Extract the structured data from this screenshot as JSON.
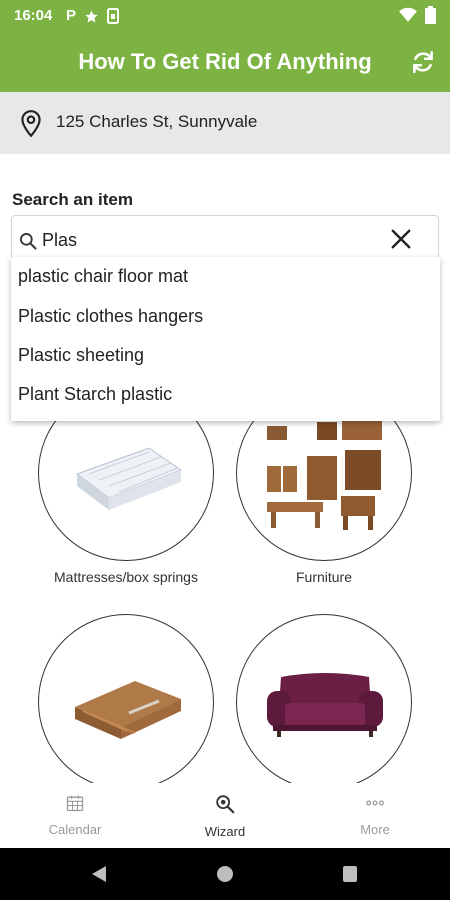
{
  "status_bar": {
    "time": "16:04",
    "left_icons": [
      "parking-icon",
      "star-icon",
      "sim-icon"
    ],
    "right_icons": [
      "wifi-icon",
      "battery-icon"
    ]
  },
  "app_bar": {
    "title": "How To Get Rid Of Anything",
    "background": "#7cb342"
  },
  "location": {
    "address": "125 Charles St, Sunnyvale"
  },
  "search": {
    "label": "Search an item",
    "value": "Plas",
    "suggestions": [
      "plastic chair floor mat",
      "Plastic clothes hangers",
      "Plastic sheeting",
      "Plant Starch plastic"
    ]
  },
  "categories": [
    {
      "label": "Mattresses/box springs",
      "icon": "mattress-image"
    },
    {
      "label": "Furniture",
      "icon": "furniture-image"
    },
    {
      "label": "",
      "icon": "cardboard-image"
    },
    {
      "label": "",
      "icon": "sofa-image"
    }
  ],
  "bottom_nav": {
    "items": [
      {
        "label": "Calendar",
        "icon": "calendar-icon",
        "active": false
      },
      {
        "label": "Wizard",
        "icon": "wizard-search-icon",
        "active": true
      },
      {
        "label": "More",
        "icon": "more-icon",
        "active": false
      }
    ]
  },
  "colors": {
    "accent": "#7cb342",
    "location_bg": "#e8e8e8",
    "inactive_nav": "#9a9a9a",
    "active_nav": "#333333"
  }
}
